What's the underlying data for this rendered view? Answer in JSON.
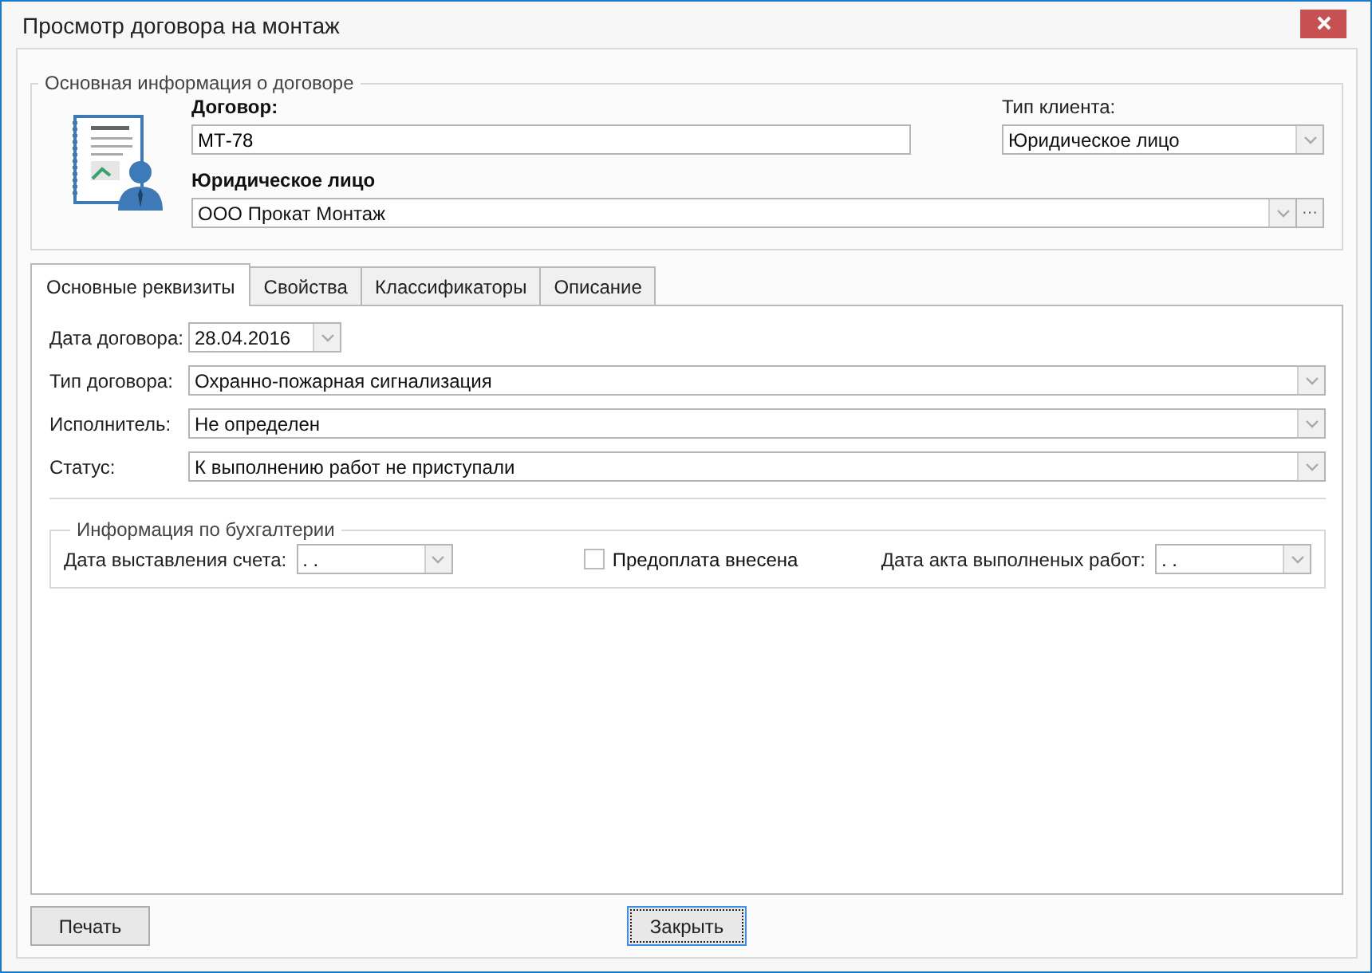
{
  "window": {
    "title": "Просмотр договора на монтаж"
  },
  "main_info": {
    "title": "Основная информация о договоре",
    "contract": {
      "label": "Договор:",
      "value": "МТ-78"
    },
    "client_type": {
      "label": "Тип клиента:",
      "value": "Юридическое лицо"
    },
    "legal_entity": {
      "label": "Юридическое лицо",
      "value": "ООО Прокат Монтаж",
      "browse": "···"
    }
  },
  "tabs": [
    {
      "label": "Основные реквизиты",
      "selected": true
    },
    {
      "label": "Свойства",
      "selected": false
    },
    {
      "label": "Классификаторы",
      "selected": false
    },
    {
      "label": "Описание",
      "selected": false
    }
  ],
  "fields": [
    {
      "label": "Дата договора:",
      "value": "28.04.2016",
      "kind": "date"
    },
    {
      "label": "Тип договора:",
      "value": "Охранно-пожарная сигнализация",
      "kind": "combo"
    },
    {
      "label": "Исполнитель:",
      "value": "Не определен",
      "kind": "combo"
    },
    {
      "label": "Статус:",
      "value": "К выполнению работ не приступали",
      "kind": "combo"
    }
  ],
  "accounting": {
    "title": "Информация по бухгалтерии",
    "invoice_date": {
      "label": "Дата выставления счета:",
      "value": ". ."
    },
    "prepaid": {
      "label": "Предоплата внесена",
      "checked": false
    },
    "act_date": {
      "label": "Дата акта выполненых работ:",
      "value": ". ."
    }
  },
  "buttons": [
    {
      "label": "Печать",
      "focused": false
    },
    {
      "label": "Закрыть",
      "focused": true
    }
  ]
}
